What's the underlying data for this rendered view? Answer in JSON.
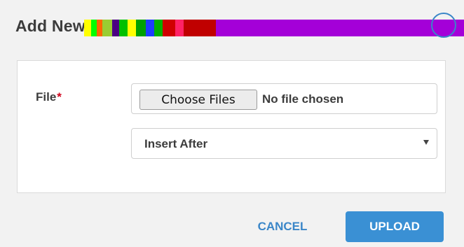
{
  "dialog": {
    "title": "Add New",
    "close_icon": "close-circle-icon",
    "accent_color": "#3a90d4"
  },
  "form": {
    "file_label": "File",
    "required_mark": "*",
    "choose_button_label": "Choose Files",
    "file_status": "No file chosen",
    "position_select": {
      "selected": "Insert After"
    }
  },
  "footer": {
    "cancel_label": "CANCEL",
    "upload_label": "UPLOAD"
  }
}
